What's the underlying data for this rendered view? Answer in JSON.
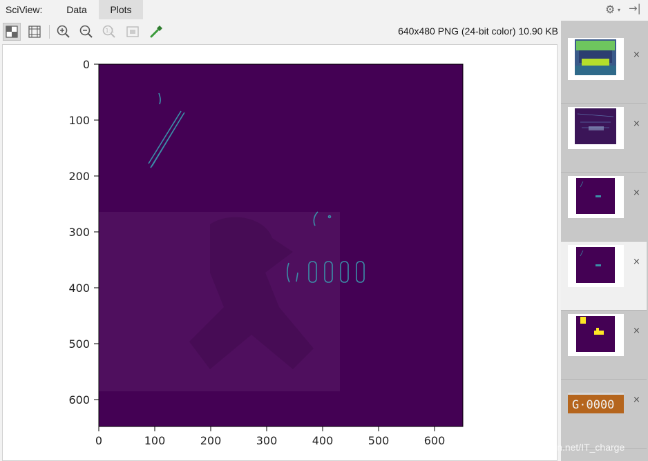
{
  "header": {
    "tool_label": "SciView:",
    "tabs": [
      {
        "label": "Data",
        "active": false
      },
      {
        "label": "Plots",
        "active": true
      }
    ]
  },
  "toolbar": {
    "buttons": [
      "chessboard-icon",
      "grid-icon",
      "zoom-in-icon",
      "zoom-out-icon",
      "actual-size-icon",
      "fit-icon",
      "color-picker-icon"
    ],
    "image_info": "640x480 PNG (24-bit color) 10.90 KB"
  },
  "plot": {
    "y_ticks": [
      "0",
      "100",
      "200",
      "300",
      "400",
      "500",
      "600"
    ],
    "x_ticks": [
      "0",
      "100",
      "200",
      "300",
      "400",
      "500",
      "600"
    ],
    "background_color": "#440154",
    "edge_color": "#3b8fa8"
  },
  "thumbnails": {
    "items": [
      {
        "name": "thumb-car-viridis",
        "selected": false
      },
      {
        "name": "thumb-car-edges",
        "selected": false
      },
      {
        "name": "thumb-edges-1",
        "selected": false
      },
      {
        "name": "thumb-edges-2",
        "selected": true
      },
      {
        "name": "thumb-yellow-mask",
        "selected": false
      },
      {
        "name": "thumb-plate",
        "selected": false
      }
    ],
    "close_label": "×",
    "plate_text": "G·0000"
  },
  "watermark": "https://blog.csdn.net/IT_charge"
}
